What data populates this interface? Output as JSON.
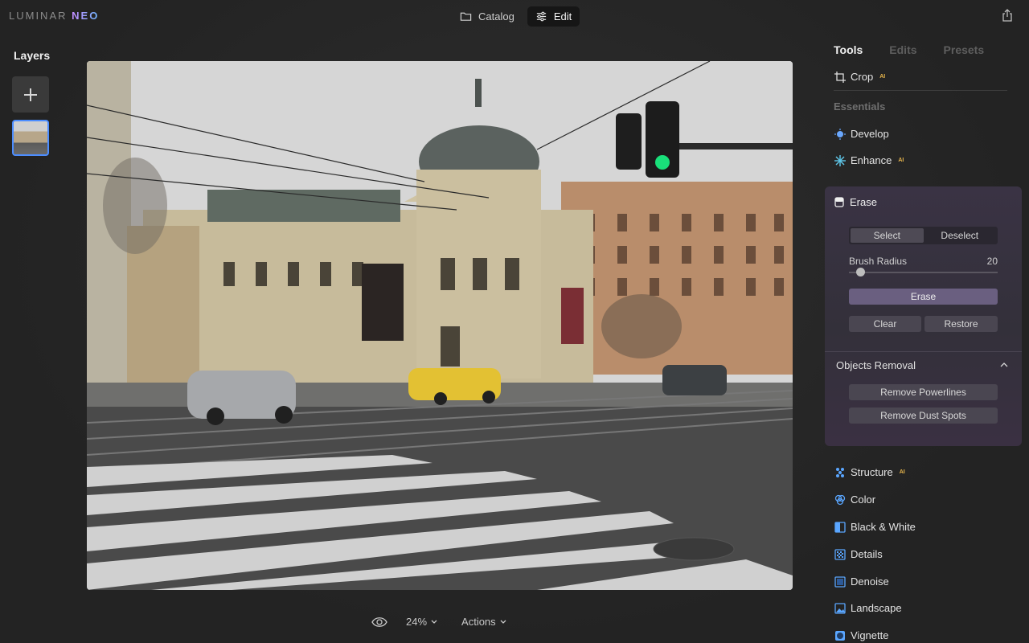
{
  "app": {
    "logo_main": "LUMINAR",
    "logo_accent": "NEO"
  },
  "top_tabs": [
    {
      "label": "Catalog",
      "icon": "folder-icon",
      "active": false
    },
    {
      "label": "Edit",
      "icon": "sliders-icon",
      "active": true
    }
  ],
  "layers": {
    "title": "Layers"
  },
  "bottom_bar": {
    "zoom": "24%",
    "actions": "Actions"
  },
  "panel": {
    "tabs": [
      "Tools",
      "Edits",
      "Presets"
    ],
    "crop": "Crop",
    "ai_badge": "AI",
    "essentials": "Essentials",
    "develop": "Develop",
    "enhance": "Enhance",
    "erase": {
      "title": "Erase",
      "select": "Select",
      "deselect": "Deselect",
      "brush_radius_label": "Brush Radius",
      "brush_radius_value": "20",
      "erase_button": "Erase",
      "clear": "Clear",
      "restore": "Restore",
      "objects_removal": "Objects Removal",
      "remove_powerlines": "Remove Powerlines",
      "remove_dust": "Remove Dust Spots"
    },
    "tools": [
      {
        "label": "Structure",
        "ai": true,
        "icon": "structure-icon"
      },
      {
        "label": "Color",
        "ai": false,
        "icon": "color-icon"
      },
      {
        "label": "Black & White",
        "ai": false,
        "icon": "bw-icon"
      },
      {
        "label": "Details",
        "ai": false,
        "icon": "details-icon"
      },
      {
        "label": "Denoise",
        "ai": false,
        "icon": "denoise-icon"
      },
      {
        "label": "Landscape",
        "ai": false,
        "icon": "landscape-icon"
      },
      {
        "label": "Vignette",
        "ai": false,
        "icon": "vignette-icon"
      }
    ]
  },
  "colors": {
    "accent_blue": "#4c8dff",
    "ai_gold": "#e8b64c",
    "erase_btn": "#6a5f80"
  }
}
